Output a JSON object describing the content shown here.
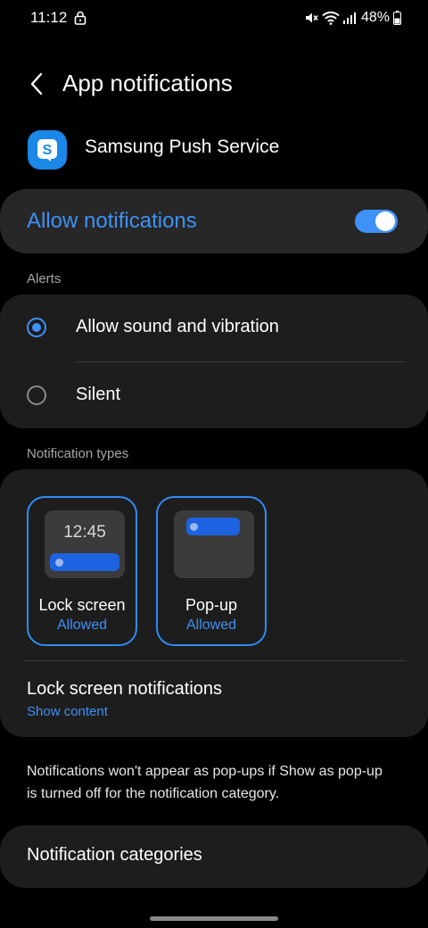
{
  "status_bar": {
    "time": "11:12",
    "battery": "48%",
    "icons": [
      "lock-icon",
      "mute-icon",
      "wifi-icon",
      "signal-icon",
      "battery-icon"
    ]
  },
  "header": {
    "title": "App notifications",
    "back_icon": "chevron-left-icon"
  },
  "app": {
    "name": "Samsung Push Service",
    "icon_letter": "S",
    "icon_color": "#1b87e6"
  },
  "allow_notifications": {
    "label": "Allow notifications",
    "enabled": true
  },
  "alerts": {
    "header": "Alerts",
    "options": [
      {
        "label": "Allow sound and vibration",
        "selected": true
      },
      {
        "label": "Silent",
        "selected": false
      }
    ]
  },
  "notification_types": {
    "header": "Notification types",
    "tiles": [
      {
        "label": "Lock screen",
        "status": "Allowed",
        "preview_time": "12:45"
      },
      {
        "label": "Pop-up",
        "status": "Allowed"
      }
    ],
    "lock_screen_notifications": {
      "title": "Lock screen notifications",
      "value": "Show content"
    }
  },
  "note": "Notifications won't appear as pop-ups if Show as pop-up is turned off for the notification category.",
  "categories": {
    "label": "Notification categories"
  },
  "colors": {
    "accent": "#3e91f6",
    "background": "#000000",
    "card": "#1d1d1d"
  }
}
